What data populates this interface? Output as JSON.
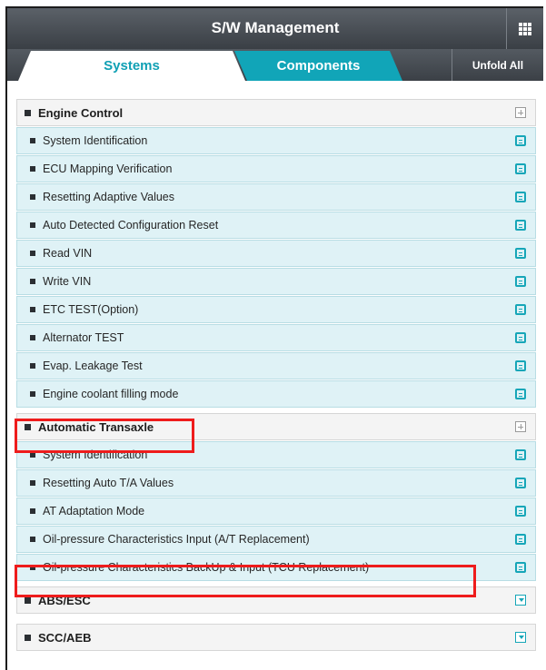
{
  "window": {
    "title": "S/W Management",
    "grid_icon": "grid-menu-icon"
  },
  "tabs": [
    {
      "label": "Systems",
      "active": true
    },
    {
      "label": "Components",
      "active": false
    }
  ],
  "unfold_all_label": "Unfold All",
  "colors": {
    "accent": "#11a5b8",
    "highlight": "#ee1c1c",
    "item_bg": "#dff2f6"
  },
  "groups": [
    {
      "label": "Engine Control",
      "items": [
        "System Identification",
        "ECU Mapping Verification",
        "Resetting Adaptive Values",
        "Auto Detected Configuration Reset",
        "Read VIN",
        "Write VIN",
        "ETC TEST(Option)",
        "Alternator TEST",
        "Evap. Leakage Test",
        "Engine coolant filling mode"
      ]
    },
    {
      "label": "Automatic Transaxle",
      "items": [
        "System Identification",
        "Resetting Auto T/A Values",
        "AT Adaptation Mode",
        "Oil-pressure Characteristics Input (A/T Replacement)",
        "Oil-pressure Characteristics BackUp & Input (TCU Replacement)"
      ]
    },
    {
      "label": "ABS/ESC",
      "items": []
    },
    {
      "label": "SCC/AEB",
      "items": []
    }
  ]
}
